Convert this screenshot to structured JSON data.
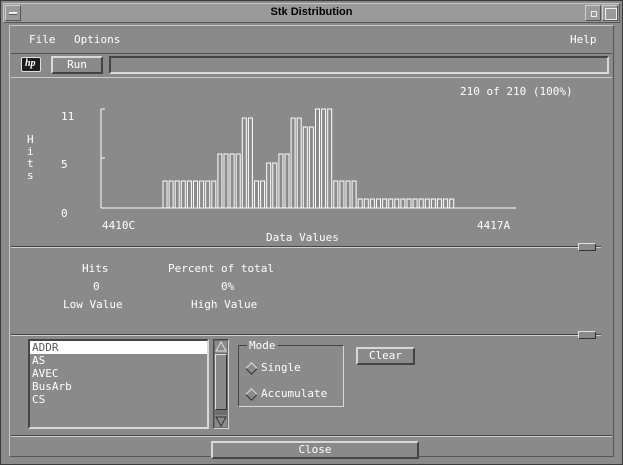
{
  "window": {
    "title": "Stk Distribution"
  },
  "menubar": {
    "file": "File",
    "options": "Options",
    "help": "Help"
  },
  "toolbar": {
    "run_label": "Run",
    "logo_text": "hp"
  },
  "chart_data": {
    "type": "bar",
    "count_label": "210 of 210 (100%)",
    "ylabel": "Hits",
    "xlabel": "Data Values",
    "yticks": [
      "11",
      "5",
      "0"
    ],
    "ylim": [
      0,
      11
    ],
    "x_start_label": "4410C",
    "x_end_label": "4417A",
    "values": [
      3,
      3,
      3,
      3,
      3,
      3,
      3,
      3,
      3,
      6,
      6,
      6,
      6,
      10,
      10,
      3,
      3,
      5,
      5,
      6,
      6,
      10,
      10,
      9,
      9,
      11,
      11,
      11,
      3,
      3,
      3,
      3,
      1,
      1,
      1,
      1,
      1,
      1,
      1,
      1,
      1,
      1,
      1,
      1,
      1,
      1,
      1,
      1
    ]
  },
  "stats": {
    "hits_label": "Hits",
    "percent_label": "Percent of total",
    "hits_value": "0",
    "percent_value": "0%",
    "low_label": "Low Value",
    "high_label": "High Value"
  },
  "list": {
    "items": [
      "ADDR",
      "AS",
      "AVEC",
      "BusArb",
      "CS"
    ],
    "selected": "ADDR"
  },
  "mode": {
    "title": "Mode",
    "single": "Single",
    "accumulate": "Accumulate"
  },
  "buttons": {
    "clear": "Clear",
    "close": "Close"
  }
}
